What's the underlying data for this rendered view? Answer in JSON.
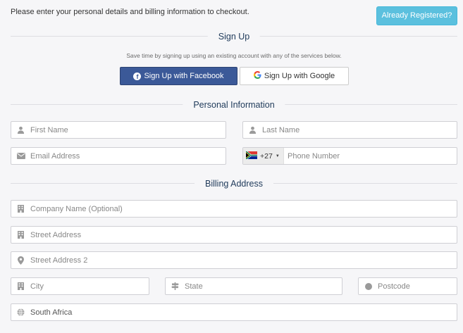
{
  "intro_text": "Please enter your personal details and billing information to checkout.",
  "already_registered_label": "Already Registered?",
  "sections": {
    "signup": "Sign Up",
    "personal": "Personal Information",
    "billing": "Billing Address"
  },
  "signup_note": "Save time by signing up using an existing account with any of the services below.",
  "facebook_label": "Sign Up with Facebook",
  "google_label": "Sign Up with Google",
  "fields": {
    "first_name": "First Name",
    "last_name": "Last Name",
    "email": "Email Address",
    "phone_code": "+27",
    "phone": "Phone Number",
    "company": "Company Name (Optional)",
    "street": "Street Address",
    "street2": "Street Address 2",
    "city": "City",
    "state": "State",
    "postcode": "Postcode",
    "country": "South Africa"
  },
  "colors": {
    "accent": "#5bc0de",
    "facebook": "#3b5998",
    "section_title": "#1f3a5a"
  }
}
